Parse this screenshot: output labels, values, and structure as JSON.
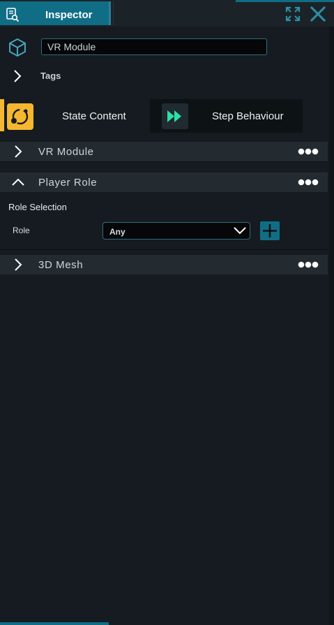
{
  "tab": {
    "title": "Inspector",
    "icon": "inspector-icon"
  },
  "window_buttons": {
    "maximize": "maximize-icon",
    "close": "close-icon"
  },
  "object": {
    "name": "VR Module"
  },
  "tags": {
    "label": "Tags"
  },
  "mode": {
    "state_label": "State Content",
    "step_label": "Step Behaviour",
    "active": "state"
  },
  "sections": [
    {
      "title": "VR Module",
      "expanded": false
    },
    {
      "title": "Player Role",
      "expanded": true
    },
    {
      "title": "3D Mesh",
      "expanded": false
    }
  ],
  "player_role": {
    "group_label": "Role Selection",
    "role_label": "Role",
    "role_value": "Any"
  },
  "colors": {
    "accent_teal": "#0f6e86",
    "accent_orange": "#f5b630",
    "accent_green": "#2de0a6",
    "background": "#151b20"
  }
}
